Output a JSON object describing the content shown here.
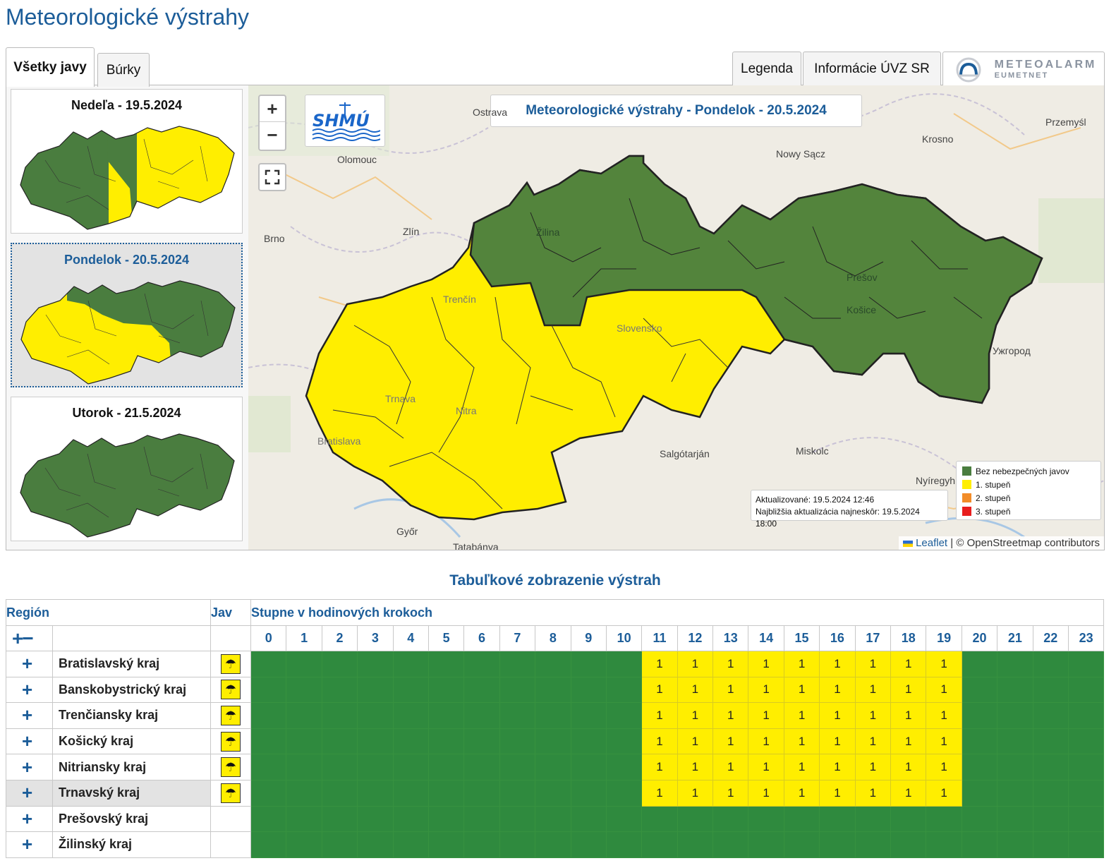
{
  "page": {
    "title": "Meteorologické výstrahy"
  },
  "tabs": {
    "all": "Všetky javy",
    "storms": "Búrky",
    "legend": "Legenda",
    "info": "Informácie ÚVZ SR",
    "meteoalarm": "METEOALARM",
    "eumetnet": "EUMETNET"
  },
  "days": [
    {
      "label": "Nedeľa - 19.5.2024"
    },
    {
      "label": "Pondelok - 20.5.2024"
    },
    {
      "label": "Utorok - 21.5.2024"
    }
  ],
  "map": {
    "title": "Meteorologické výstrahy - Pondelok - 20.5.2024",
    "zoom_in": "+",
    "zoom_out": "−",
    "logo": "SHMÚ",
    "places": [
      "Ostrava",
      "Olomouc",
      "Zlín",
      "Brno",
      "Nowy Sącz",
      "Krosno",
      "Przemyśl",
      "Žilina",
      "Trenčín",
      "Prešov",
      "Košice",
      "Slovensko",
      "Ужгород",
      "Trnava",
      "Nitra",
      "Bratislava",
      "Salgótarján",
      "Miskolc",
      "Nyíregyháza",
      "Győr",
      "Tatabánya"
    ],
    "updated": "Aktualizované: 19.5.2024 12:46",
    "next_update": "Najbližšia aktualizácia najneskôr: 19.5.2024 18:00",
    "attribution_link": "Leaflet",
    "attribution_text": "| © OpenStreetmap contributors",
    "legend": [
      {
        "label": "Bez nebezpečných javov",
        "color": "#4a7d3f"
      },
      {
        "label": "1. stupeň",
        "color": "#ffee00"
      },
      {
        "label": "2. stupeň",
        "color": "#f28c28"
      },
      {
        "label": "3. stupeň",
        "color": "#e81e1e"
      }
    ]
  },
  "table": {
    "title": "Tabuľkové zobrazenie výstrah",
    "col_region": "Región",
    "col_jav": "Jav",
    "col_steps": "Stupne v hodinových krokoch",
    "expand_controls": "+−",
    "hours": [
      "0",
      "1",
      "2",
      "3",
      "4",
      "5",
      "6",
      "7",
      "8",
      "9",
      "10",
      "11",
      "12",
      "13",
      "14",
      "15",
      "16",
      "17",
      "18",
      "19",
      "20",
      "21",
      "22",
      "23"
    ],
    "rows": [
      {
        "expand": "+",
        "name": "Bratislavský kraj",
        "warning": true,
        "levels": [
          0,
          0,
          0,
          0,
          0,
          0,
          0,
          0,
          0,
          0,
          0,
          1,
          1,
          1,
          1,
          1,
          1,
          1,
          1,
          1,
          0,
          0,
          0,
          0
        ]
      },
      {
        "expand": "+",
        "name": "Banskobystrický kraj",
        "warning": true,
        "levels": [
          0,
          0,
          0,
          0,
          0,
          0,
          0,
          0,
          0,
          0,
          0,
          1,
          1,
          1,
          1,
          1,
          1,
          1,
          1,
          1,
          0,
          0,
          0,
          0
        ]
      },
      {
        "expand": "+",
        "name": "Trenčiansky kraj",
        "warning": true,
        "levels": [
          0,
          0,
          0,
          0,
          0,
          0,
          0,
          0,
          0,
          0,
          0,
          1,
          1,
          1,
          1,
          1,
          1,
          1,
          1,
          1,
          0,
          0,
          0,
          0
        ]
      },
      {
        "expand": "+",
        "name": "Košický kraj",
        "warning": true,
        "levels": [
          0,
          0,
          0,
          0,
          0,
          0,
          0,
          0,
          0,
          0,
          0,
          1,
          1,
          1,
          1,
          1,
          1,
          1,
          1,
          1,
          0,
          0,
          0,
          0
        ]
      },
      {
        "expand": "+",
        "name": "Nitriansky kraj",
        "warning": true,
        "levels": [
          0,
          0,
          0,
          0,
          0,
          0,
          0,
          0,
          0,
          0,
          0,
          1,
          1,
          1,
          1,
          1,
          1,
          1,
          1,
          1,
          0,
          0,
          0,
          0
        ]
      },
      {
        "expand": "+",
        "name": "Trnavský kraj",
        "warning": true,
        "levels": [
          0,
          0,
          0,
          0,
          0,
          0,
          0,
          0,
          0,
          0,
          0,
          1,
          1,
          1,
          1,
          1,
          1,
          1,
          1,
          1,
          0,
          0,
          0,
          0
        ]
      },
      {
        "expand": "+",
        "name": "Prešovský kraj",
        "warning": false,
        "levels": [
          0,
          0,
          0,
          0,
          0,
          0,
          0,
          0,
          0,
          0,
          0,
          0,
          0,
          0,
          0,
          0,
          0,
          0,
          0,
          0,
          0,
          0,
          0,
          0
        ]
      },
      {
        "expand": "+",
        "name": "Žilinský kraj",
        "warning": false,
        "levels": [
          0,
          0,
          0,
          0,
          0,
          0,
          0,
          0,
          0,
          0,
          0,
          0,
          0,
          0,
          0,
          0,
          0,
          0,
          0,
          0,
          0,
          0,
          0,
          0
        ]
      }
    ]
  },
  "colors": {
    "green": "#2f8a3e",
    "map_green": "#4a7d3f",
    "yellow": "#ffee00",
    "accent": "#1c5d99"
  }
}
